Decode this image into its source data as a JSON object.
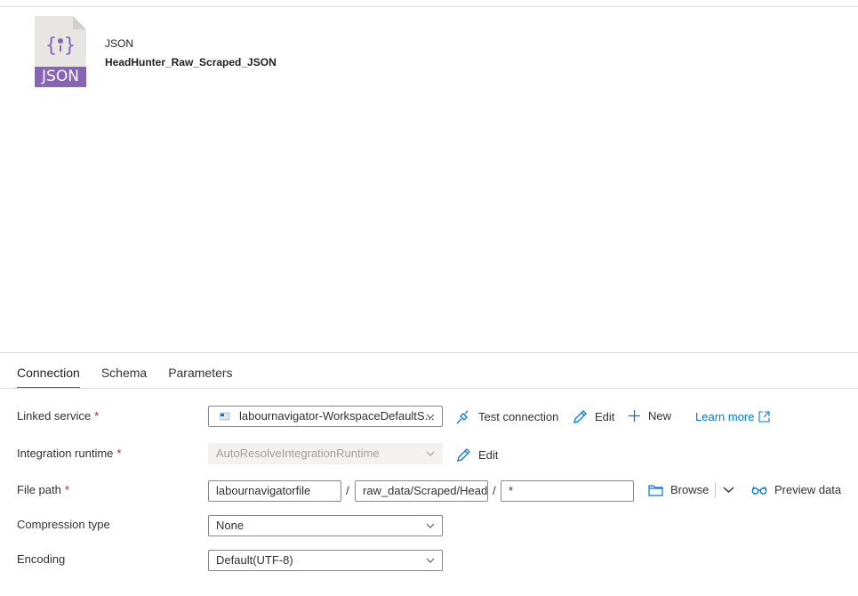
{
  "dataset": {
    "type": "JSON",
    "name": "HeadHunter_Raw_Scraped_JSON",
    "icon_label": "JSON",
    "icon_glyph": "{•}",
    "icon_color": "#8764b8"
  },
  "tabs": [
    {
      "label": "Connection",
      "active": true
    },
    {
      "label": "Schema",
      "active": false
    },
    {
      "label": "Parameters",
      "active": false
    }
  ],
  "form": {
    "linked_service": {
      "label": "Linked service",
      "required": "*",
      "value": "labournavigator-WorkspaceDefaultS...",
      "test_connection": "Test connection",
      "edit": "Edit",
      "new": "New",
      "learn_more": "Learn more"
    },
    "integration_runtime": {
      "label": "Integration runtime",
      "required": "*",
      "value": "AutoResolveIntegrationRuntime",
      "edit": "Edit"
    },
    "file_path": {
      "label": "File path",
      "required": "*",
      "container": "labournavigatorfile",
      "directory": "raw_data/Scraped/Head",
      "file": "*",
      "separator": "/",
      "browse": "Browse",
      "preview": "Preview data"
    },
    "compression_type": {
      "label": "Compression type",
      "value": "None"
    },
    "encoding": {
      "label": "Encoding",
      "value": "Default(UTF-8)"
    }
  },
  "colors": {
    "accent": "#0078d4",
    "required": "#a4262c",
    "json_purple": "#8764b8"
  }
}
